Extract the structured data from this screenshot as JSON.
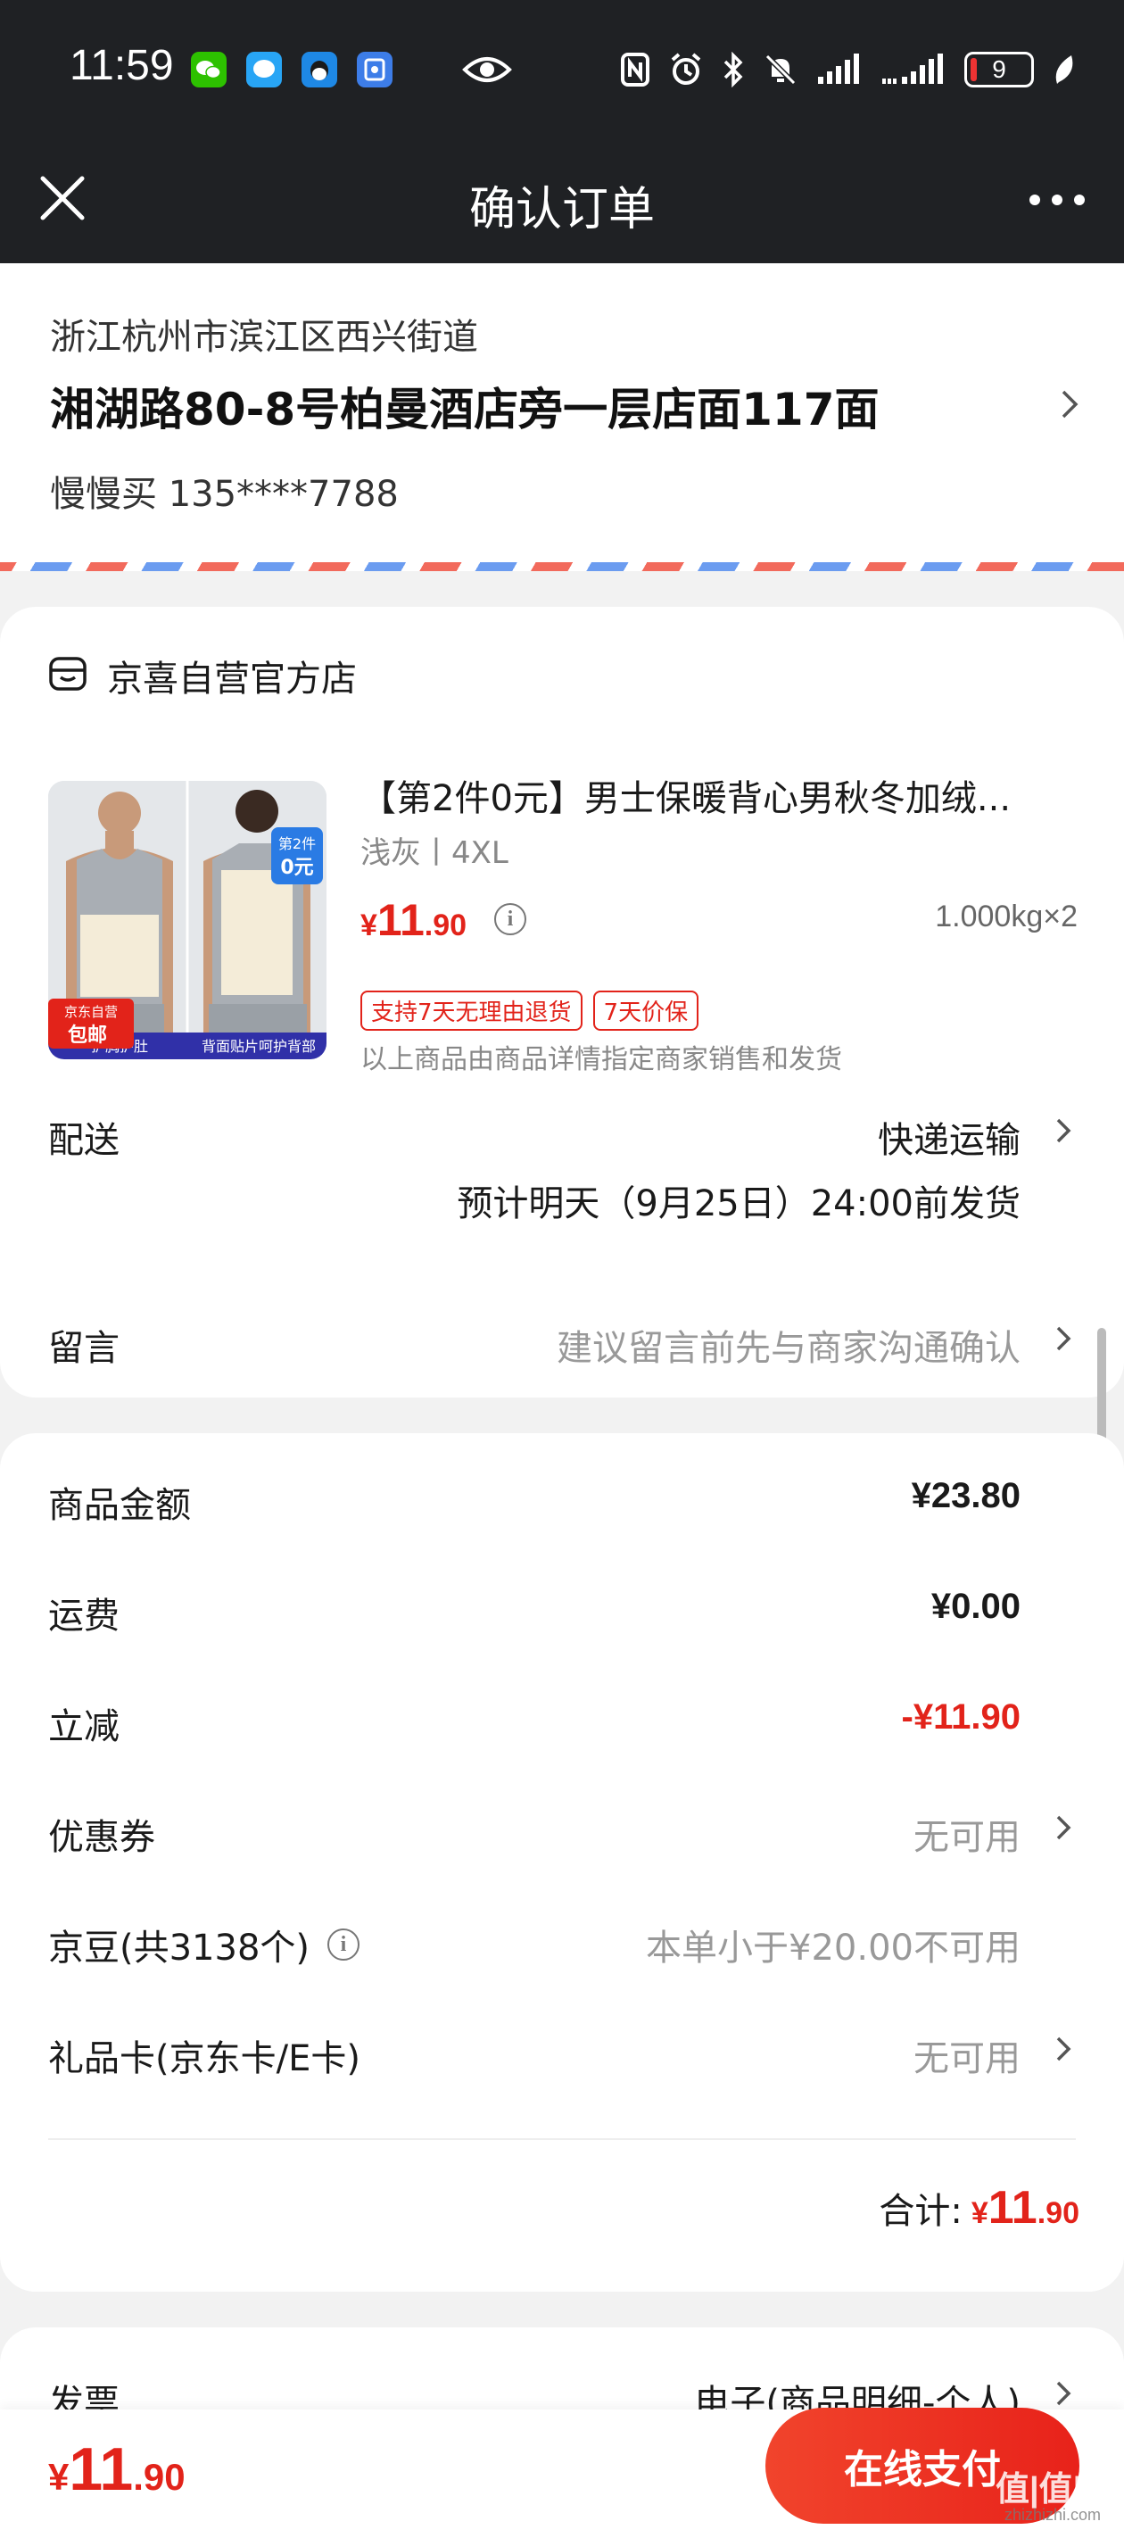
{
  "status_bar": {
    "time": "11:59",
    "battery": "9"
  },
  "nav": {
    "title": "确认订单"
  },
  "address": {
    "region": "浙江杭州市滨江区西兴街道",
    "detail": "湘湖路80-8号柏曼酒店旁一层店面117面",
    "contact": "慢慢买  135****7788"
  },
  "shop": {
    "name": "京喜自营官方店",
    "product": {
      "title": "【第2件0元】男士保暖背心男秋冬加绒...",
      "spec": "浅灰丨4XL",
      "price_currency": "¥",
      "price_int": "11",
      "price_dec": ".90",
      "weight_qty": "1.000kg×2",
      "tags": [
        "支持7天无理由退货",
        "7天价保"
      ],
      "seller_note": "以上商品由商品详情指定商家销售和发货",
      "image_badge_top": "第2件",
      "image_badge_bottom": "0元",
      "image_label_self": "京东自营",
      "image_label_ship": "包邮",
      "image_caption_left": "护胸护肚",
      "image_caption_right": "背面贴片呵护背部"
    },
    "delivery": {
      "label": "配送",
      "method": "快递运输",
      "eta": "预计明天（9月25日）24:00前发货"
    },
    "message": {
      "label": "留言",
      "placeholder": "建议留言前先与商家沟通确认"
    }
  },
  "costs": {
    "rows": [
      {
        "label": "商品金额",
        "value": "¥23.80"
      },
      {
        "label": "运费",
        "value": "¥0.00"
      },
      {
        "label": "立减",
        "value": "-¥11.90"
      },
      {
        "label": "优惠券",
        "value": "无可用"
      },
      {
        "label": "京豆(共3138个)",
        "value": "本单小于¥20.00不可用"
      },
      {
        "label": "礼品卡(京东卡/E卡)",
        "value": "无可用"
      }
    ],
    "total_label": "合计:",
    "total_currency": "¥",
    "total_int": "11",
    "total_dec": ".90"
  },
  "invoice": {
    "label": "发票",
    "value": "电子(商品明细-个人)"
  },
  "bottom": {
    "currency": "¥",
    "int": "11",
    "dec": ".90",
    "pay_label": "在线支付"
  },
  "watermark": {
    "main": "值|值|值",
    "sub": "zhizhizhi.com"
  },
  "colors": {
    "accent_red": "#e2231a",
    "dark_bar": "#1f2124",
    "page_bg": "#f2f2f2"
  },
  "icons": [
    "wechat-icon",
    "chat-icon",
    "qq-icon",
    "alipay-icon",
    "eye-icon",
    "nfc-icon",
    "alarm-icon",
    "bluetooth-icon",
    "mute-icon",
    "signal-icon",
    "battery-icon",
    "leaf-icon",
    "close-icon",
    "more-icon",
    "chevron-right-icon",
    "shop-icon",
    "info-icon"
  ]
}
